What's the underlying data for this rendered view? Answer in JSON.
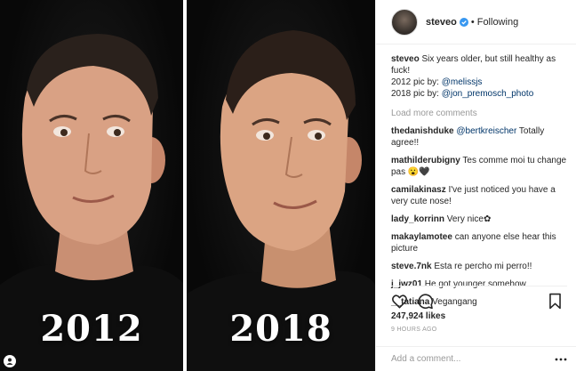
{
  "photos": {
    "left_year": "2012",
    "right_year": "2018"
  },
  "header": {
    "username": "steveo",
    "separator": "•",
    "follow_status": "Following"
  },
  "caption": {
    "user": "steveo",
    "text": "Six years older, but still healthy as fuck!",
    "line2_prefix": "2012 pic by: ",
    "line2_mention": "@melissjs",
    "line3_prefix": "2018 pic by: ",
    "line3_mention": "@jon_premosch_photo"
  },
  "load_more": "Load more comments",
  "comments": [
    {
      "user": "thedanishduke",
      "mention": "@bertkreischer",
      "text": " Totally agree!!"
    },
    {
      "user": "mathilderubigny",
      "mention": "",
      "text": " Tes comme moi tu change pas 😮🖤"
    },
    {
      "user": "camilakinasz",
      "mention": "",
      "text": " I've just noticed you have a very cute nose!"
    },
    {
      "user": "lady_korrinn",
      "mention": "",
      "text": " Very nice✿"
    },
    {
      "user": "makaylamotee",
      "mention": "",
      "text": " can anyone else hear this picture"
    },
    {
      "user": "steve.7nk",
      "mention": "",
      "text": " Esta re percho mi perro!!"
    },
    {
      "user": "j_jwz01",
      "mention": "",
      "text": " He got younger somehow"
    },
    {
      "user": "__tatiana",
      "mention": "",
      "text": " Vegangang"
    }
  ],
  "likes": "247,924 likes",
  "time": "9 HOURS AGO",
  "add_comment": {
    "placeholder": "Add a comment..."
  },
  "colors": {
    "accent_blue": "#3897f0",
    "mention": "#003569",
    "muted": "#999999",
    "text": "#262626",
    "border": "#efefef"
  },
  "icons": {
    "heart": "heart-icon",
    "comment": "comment-icon",
    "bookmark": "bookmark-icon",
    "verified": "verified-badge-icon",
    "more": "more-options-icon"
  }
}
